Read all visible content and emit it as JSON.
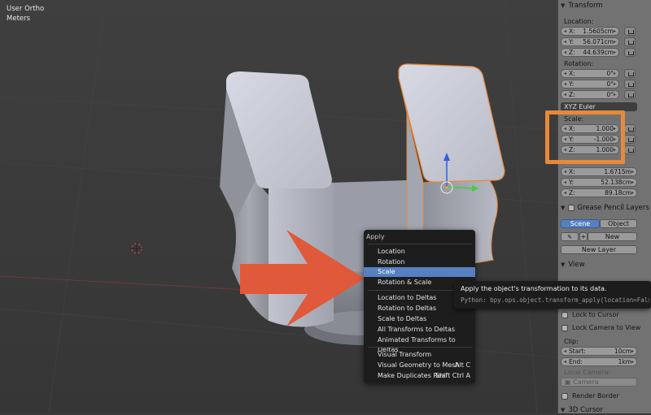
{
  "viewport": {
    "mode_label": "User Ortho",
    "units_label": "Meters"
  },
  "transform": {
    "header": "Transform",
    "location_label": "Location:",
    "location": [
      {
        "axis": "X:",
        "value": "1.5605cm"
      },
      {
        "axis": "Y:",
        "value": "56.071cm"
      },
      {
        "axis": "Z:",
        "value": "44.639cm"
      }
    ],
    "rotation_label": "Rotation:",
    "rotation": [
      {
        "axis": "X:",
        "value": "0°"
      },
      {
        "axis": "Y:",
        "value": "0°"
      },
      {
        "axis": "Z:",
        "value": "0°"
      }
    ],
    "rotation_mode": "XYZ Euler",
    "scale_label": "Scale:",
    "scale": [
      {
        "axis": "X:",
        "value": "1.000"
      },
      {
        "axis": "Y:",
        "value": "-1.000"
      },
      {
        "axis": "Z:",
        "value": "1.000"
      }
    ],
    "dimensions": [
      {
        "axis": "X:",
        "value": "1.6715m"
      },
      {
        "axis": "Y:",
        "value": "52.138cm"
      },
      {
        "axis": "Z:",
        "value": "89.18cm"
      }
    ]
  },
  "grease_pencil": {
    "header": "Grease Pencil Layers",
    "scene_tab": "Scene",
    "object_tab": "Object",
    "new_button": "New",
    "new_layer_button": "New Layer"
  },
  "view": {
    "header": "View",
    "lock_to_cursor": "Lock to Cursor",
    "lock_camera_to_view": "Lock Camera to View",
    "clip_label": "Clip:",
    "clip_start_label": "Start:",
    "clip_start_value": "10cm",
    "clip_end_label": "End:",
    "clip_end_value": "1km",
    "local_camera_label": "Local Camera:",
    "camera_value": "Camera",
    "render_border": "Render Border",
    "cursor_header": "3D Cursor"
  },
  "apply_menu": {
    "title": "Apply",
    "items": [
      {
        "label": "Location",
        "shortcut": ""
      },
      {
        "label": "Rotation",
        "shortcut": ""
      },
      {
        "label": "Scale",
        "shortcut": ""
      },
      {
        "label": "Rotation & Scale",
        "shortcut": ""
      },
      {
        "label": "Location to Deltas",
        "shortcut": ""
      },
      {
        "label": "Rotation to Deltas",
        "shortcut": ""
      },
      {
        "label": "Scale to Deltas",
        "shortcut": ""
      },
      {
        "label": "All Transforms to Deltas",
        "shortcut": ""
      },
      {
        "label": "Animated Transforms to Deltas",
        "shortcut": ""
      },
      {
        "label": "Visual Transform",
        "shortcut": ""
      },
      {
        "label": "Visual Geometry to Mesh",
        "shortcut": "Alt C"
      },
      {
        "label": "Make Duplicates Real",
        "shortcut": "Shift Ctrl A"
      }
    ]
  },
  "tooltip": {
    "description": "Apply the object's transformation to its data.",
    "python": "Python: bpy.ops.object.transform_apply(location=False, ..."
  },
  "colors": {
    "highlight_box": "#e8893a",
    "arrow": "#e0593a",
    "selection_outline": "#e8893a",
    "menu_active": "#5680c2"
  }
}
